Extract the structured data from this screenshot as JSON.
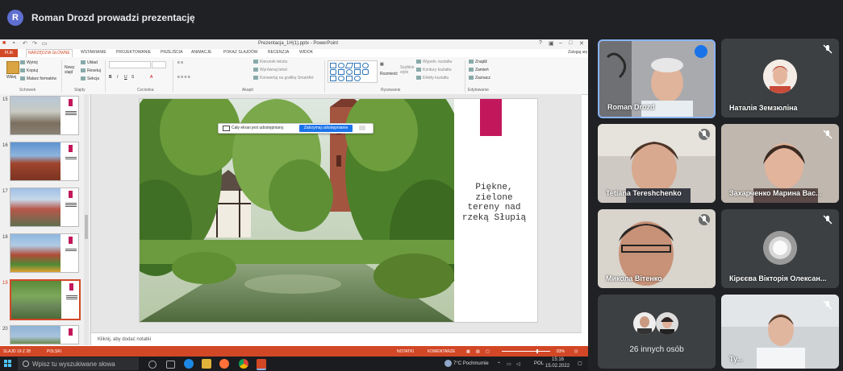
{
  "meeting": {
    "presenter_initial": "R",
    "presenting_title": "Roman Drozd prowadzi prezentację"
  },
  "powerpoint": {
    "window_title": "Prezentacja_1H(1).pptx - PowerPoint",
    "account": "Zaloguj się",
    "tabs": [
      "PLIK",
      "NARZĘDZIA GŁÓWNE",
      "WSTAWIANIE",
      "PROJEKTOWANIE",
      "PRZEJŚCIA",
      "ANIMACJE",
      "POKAZ SLAJDÓW",
      "RECENZJA",
      "WIDOK"
    ],
    "active_tab": "NARZĘDZIA GŁÓWNE",
    "ribbon": {
      "clipboard": {
        "paste": "Wklej",
        "cut": "Wytnij",
        "copy": "Kopiuj",
        "format_painter": "Malarz formatów",
        "group": "Schowek"
      },
      "slides": {
        "new_slide": "Nowy slajd",
        "layout": "Układ",
        "reset": "Resetuj",
        "section": "Sekcja",
        "group": "Slajdy"
      },
      "font": {
        "group": "Czcionka"
      },
      "paragraph": {
        "text_direction": "Kierunek tekstu",
        "align_text": "Wyrównaj tekst",
        "convert_smartart": "Konwertuj na grafikę SmartArt",
        "group": "Akapit"
      },
      "drawing": {
        "arrange": "Rozmieść",
        "quick_styles": "Szybkie style",
        "shape_fill": "Wypełn. kształtu",
        "shape_outline": "Kontury kształtu",
        "shape_effects": "Efekty kształtu",
        "group": "Rysowanie"
      },
      "editing": {
        "find": "Znajdź",
        "replace": "Zamień",
        "select": "Zaznacz",
        "group": "Edytowanie"
      }
    },
    "share_bar": {
      "text": "Cały ekran jest udostępniany.",
      "stop_button": "Zatrzymaj udostępnianie"
    },
    "thumbnails": [
      {
        "num": "15"
      },
      {
        "num": "16"
      },
      {
        "num": "17"
      },
      {
        "num": "18"
      },
      {
        "num": "19"
      },
      {
        "num": "20"
      }
    ],
    "selected_slide": "19",
    "slide": {
      "text_lines": [
        "Piękne,",
        "zielone",
        "tereny nad",
        "rzeką Słupią"
      ]
    },
    "notes_placeholder": "Kliknij, aby dodać notatki",
    "status": {
      "slide_info": "SLAJD 19 Z 28",
      "language": "POLSKI",
      "notes": "NOTATKI",
      "comments": "KOMENTARZE",
      "zoom": "83%"
    }
  },
  "taskbar": {
    "search_placeholder": "Wpisz tu wyszukiwane słowa",
    "weather": "7°C Pochmurnie",
    "language": "POL",
    "time": "15:16",
    "date": "15.02.2022"
  },
  "participants": [
    {
      "name": "Roman Drozd",
      "speaking": true
    },
    {
      "name": "Наталія Земзюліна",
      "muted": true
    },
    {
      "name": "Tetiana Tereshchenko",
      "muted": true
    },
    {
      "name": "Захарченко Марина Вас...",
      "muted": true
    },
    {
      "name": "Микола Вітенко",
      "muted": true
    },
    {
      "name": "Кірєєва Вікторія Олексан...",
      "muted": true
    },
    {
      "name": "Ту...",
      "muted": true
    }
  ],
  "others": {
    "label": "26 innych osób"
  },
  "colors": {
    "accent": "#c2185b",
    "ppt_orange": "#d24726",
    "meet_bg": "#202124",
    "tile_bg": "#3c4043",
    "share_blue": "#1a73e8"
  }
}
